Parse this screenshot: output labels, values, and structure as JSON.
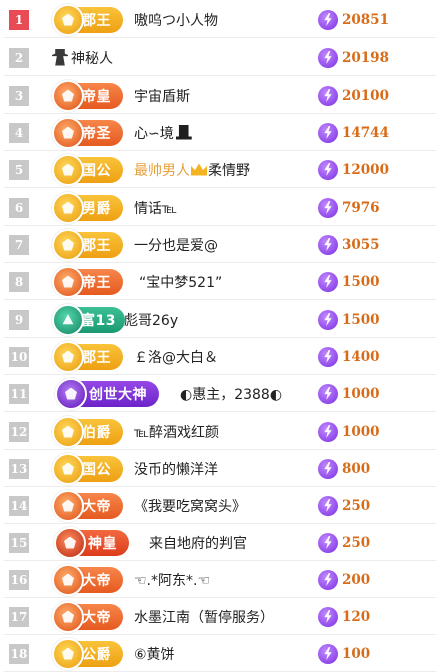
{
  "rows": [
    {
      "rank": "1",
      "badge": "郡王",
      "name": "嗷呜つ小人物",
      "score": "20851"
    },
    {
      "rank": "2",
      "badge": "",
      "name": "神秘人",
      "score": "20198"
    },
    {
      "rank": "3",
      "badge": "帝皇",
      "name": "宇宙盾斯",
      "score": "20100"
    },
    {
      "rank": "4",
      "badge": "帝圣",
      "name": "心∽境",
      "score": "14744"
    },
    {
      "rank": "5",
      "badge": "国公",
      "name_prefix": "最帅男人",
      "name": "柔情野",
      "score": "12000"
    },
    {
      "rank": "6",
      "badge": "男爵",
      "name": "情话℡",
      "score": "7976"
    },
    {
      "rank": "7",
      "badge": "郡王",
      "name": "一分也是爱@",
      "score": "3055"
    },
    {
      "rank": "8",
      "badge": "帝王",
      "name": "“宝中梦521”",
      "score": "1500"
    },
    {
      "rank": "9",
      "badge": "富13",
      "name": "彪哥26y",
      "score": "1500"
    },
    {
      "rank": "10",
      "badge": "郡王",
      "name": "￡洛@大白＆",
      "score": "1400"
    },
    {
      "rank": "11",
      "badge": "创世大神",
      "name": "◐惠主，2388◐",
      "score": "1000"
    },
    {
      "rank": "12",
      "badge": "伯爵",
      "name": "℡醉酒戏红颜",
      "score": "1000"
    },
    {
      "rank": "13",
      "badge": "国公",
      "name": "没币的懒洋洋",
      "score": "800"
    },
    {
      "rank": "14",
      "badge": "大帝",
      "name": "《我要吃窝窝头》",
      "score": "250"
    },
    {
      "rank": "15",
      "badge": "神皇",
      "name": "来自地府的判官",
      "score": "250"
    },
    {
      "rank": "16",
      "badge": "大帝",
      "name": "☜.*阿东*.☜",
      "score": "200"
    },
    {
      "rank": "17",
      "badge": "大帝",
      "name": "水墨江南（暂停服务）",
      "score": "120"
    },
    {
      "rank": "18",
      "badge": "公爵",
      "name": "⑥黄饼",
      "score": "100"
    }
  ],
  "colors": {
    "rank_first": "#e94b55",
    "rank_default": "#c8c8c8",
    "score": "#d86b18",
    "gold_text": "#e7a03c"
  }
}
